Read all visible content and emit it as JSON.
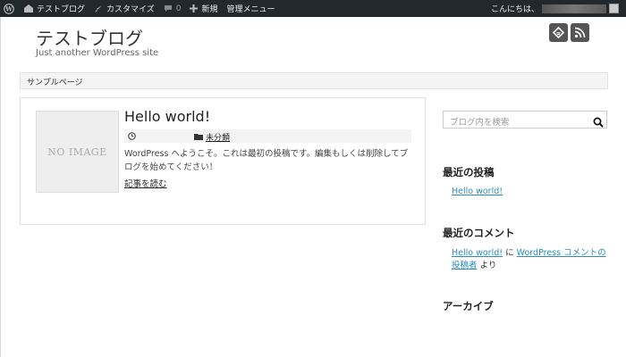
{
  "adminbar": {
    "wp_icon": "wordpress-logo-icon",
    "site_label": "テストブログ",
    "customize_label": "カスタマイズ",
    "comments_count": "0",
    "new_label": "新規",
    "admin_menu_label": "管理メニュー",
    "greeting": "こんにちは、"
  },
  "header": {
    "site_title": "テストブログ",
    "tagline": "Just another WordPress site",
    "social_icons": [
      "feedly-icon",
      "rss-icon"
    ]
  },
  "nav": {
    "items": [
      {
        "label": "サンプルページ"
      }
    ]
  },
  "post": {
    "thumbnail_text": "NO IMAGE",
    "title": "Hello world!",
    "category": "未分類",
    "excerpt": "WordPress へようこそ。これは最初の投稿です。編集もしくは削除してブログを始めてください！",
    "read_more": "記事を読む"
  },
  "sidebar": {
    "search_placeholder": "ブログ内を検索",
    "recent_posts_title": "最近の投稿",
    "recent_posts": [
      {
        "label": "Hello world!"
      }
    ],
    "recent_comments_title": "最近のコメント",
    "recent_comment": {
      "post_link": "Hello world!",
      "connector": "に",
      "author_link": "WordPress コメントの投稿者",
      "suffix": "より"
    },
    "archive_title": "アーカイブ"
  },
  "colors": {
    "adminbar_bg": "#23282d",
    "link": "#2b8dbd",
    "social_icon_bg": "#555555"
  }
}
